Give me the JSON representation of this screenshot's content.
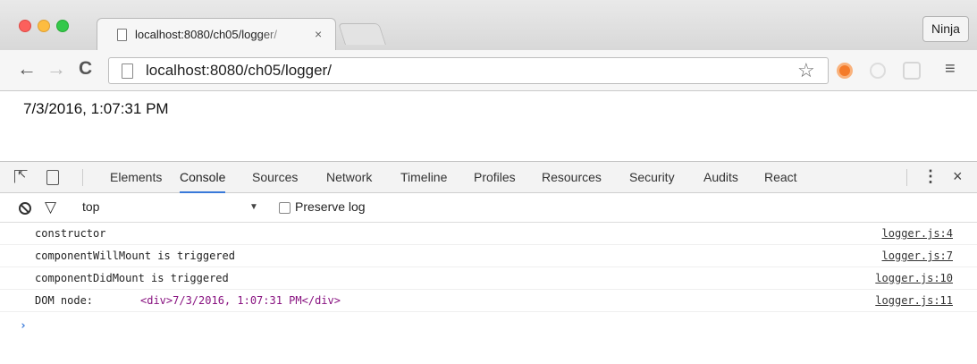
{
  "browser": {
    "tab": {
      "title": "localhost:8080/ch05/logger/",
      "close": "×"
    },
    "profile_button": "Ninja",
    "nav": {
      "back": "←",
      "forward": "→",
      "reload": "C"
    },
    "address": {
      "url": "localhost:8080/ch05/logger/",
      "star": "☆"
    },
    "menu": "≡"
  },
  "page": {
    "content_text": "7/3/2016, 1:07:31 PM"
  },
  "devtools": {
    "tabs": [
      "Elements",
      "Console",
      "Sources",
      "Network",
      "Timeline",
      "Profiles",
      "Resources",
      "Security",
      "Audits",
      "React"
    ],
    "active_tab": "Console",
    "more": "⋮",
    "close": "×",
    "console": {
      "context": "top",
      "context_arrow": "▼",
      "preserve_log_label": "Preserve log",
      "preserve_log_checked": false,
      "messages": [
        {
          "text": "constructor",
          "node": "",
          "source": "logger.js:4"
        },
        {
          "text": "componentWillMount is triggered",
          "node": "",
          "source": "logger.js:7"
        },
        {
          "text": "componentDidMount is triggered",
          "node": "",
          "source": "logger.js:10"
        },
        {
          "text": "DOM node:",
          "node": "<div>7/3/2016, 1:07:31 PM</div>",
          "source": "logger.js:11"
        }
      ],
      "prompt": "›"
    }
  },
  "colors": {
    "active_tab_underline": "#3879d9",
    "dom_node": "#881280",
    "prompt": "#3879d9"
  }
}
